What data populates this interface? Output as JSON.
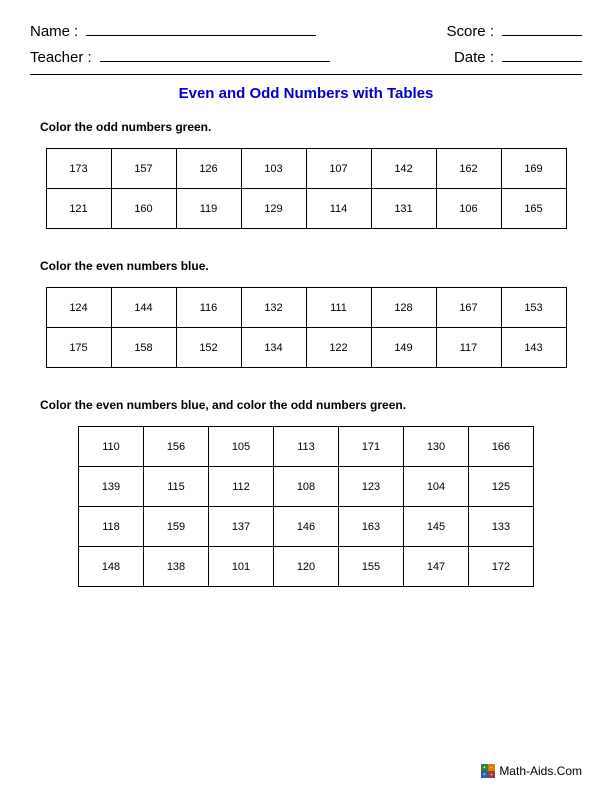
{
  "header": {
    "name_label": "Name :",
    "teacher_label": "Teacher :",
    "score_label": "Score :",
    "date_label": "Date :"
  },
  "title": "Even and Odd Numbers with Tables",
  "sections": [
    {
      "instruction": "Color the odd numbers green.",
      "rows": [
        [
          173,
          157,
          126,
          103,
          107,
          142,
          162,
          169
        ],
        [
          121,
          160,
          119,
          129,
          114,
          131,
          106,
          165
        ]
      ]
    },
    {
      "instruction": "Color the even numbers blue.",
      "rows": [
        [
          124,
          144,
          116,
          132,
          111,
          128,
          167,
          153
        ],
        [
          175,
          158,
          152,
          134,
          122,
          149,
          117,
          143
        ]
      ]
    },
    {
      "instruction": "Color the even numbers blue, and color the odd numbers green.",
      "rows": [
        [
          110,
          156,
          105,
          113,
          171,
          130,
          166
        ],
        [
          139,
          115,
          112,
          108,
          123,
          104,
          125
        ],
        [
          118,
          159,
          137,
          146,
          163,
          145,
          133
        ],
        [
          148,
          138,
          101,
          120,
          155,
          147,
          172
        ]
      ]
    }
  ],
  "footer": {
    "site": "Math-Aids.Com"
  }
}
